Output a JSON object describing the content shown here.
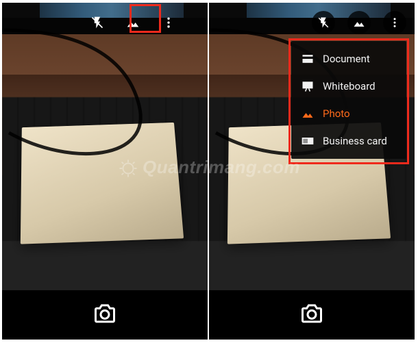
{
  "watermark": {
    "text": "Quantrimang.com"
  },
  "topbar": {
    "flash_icon": "flash-off-icon",
    "mode_icon": "image-mode-icon",
    "overflow_icon": "more-vert-icon"
  },
  "menu": {
    "items": [
      {
        "key": "document",
        "label": "Document",
        "icon": "document-icon",
        "selected": false
      },
      {
        "key": "whiteboard",
        "label": "Whiteboard",
        "icon": "whiteboard-icon",
        "selected": false
      },
      {
        "key": "photo",
        "label": "Photo",
        "icon": "image-mode-icon",
        "selected": true
      },
      {
        "key": "bizcard",
        "label": "Business card",
        "icon": "business-card-icon",
        "selected": false
      }
    ]
  },
  "capture": {
    "icon": "camera-icon"
  },
  "highlight": {
    "left_target": "mode-button",
    "right_target": "mode-menu"
  }
}
